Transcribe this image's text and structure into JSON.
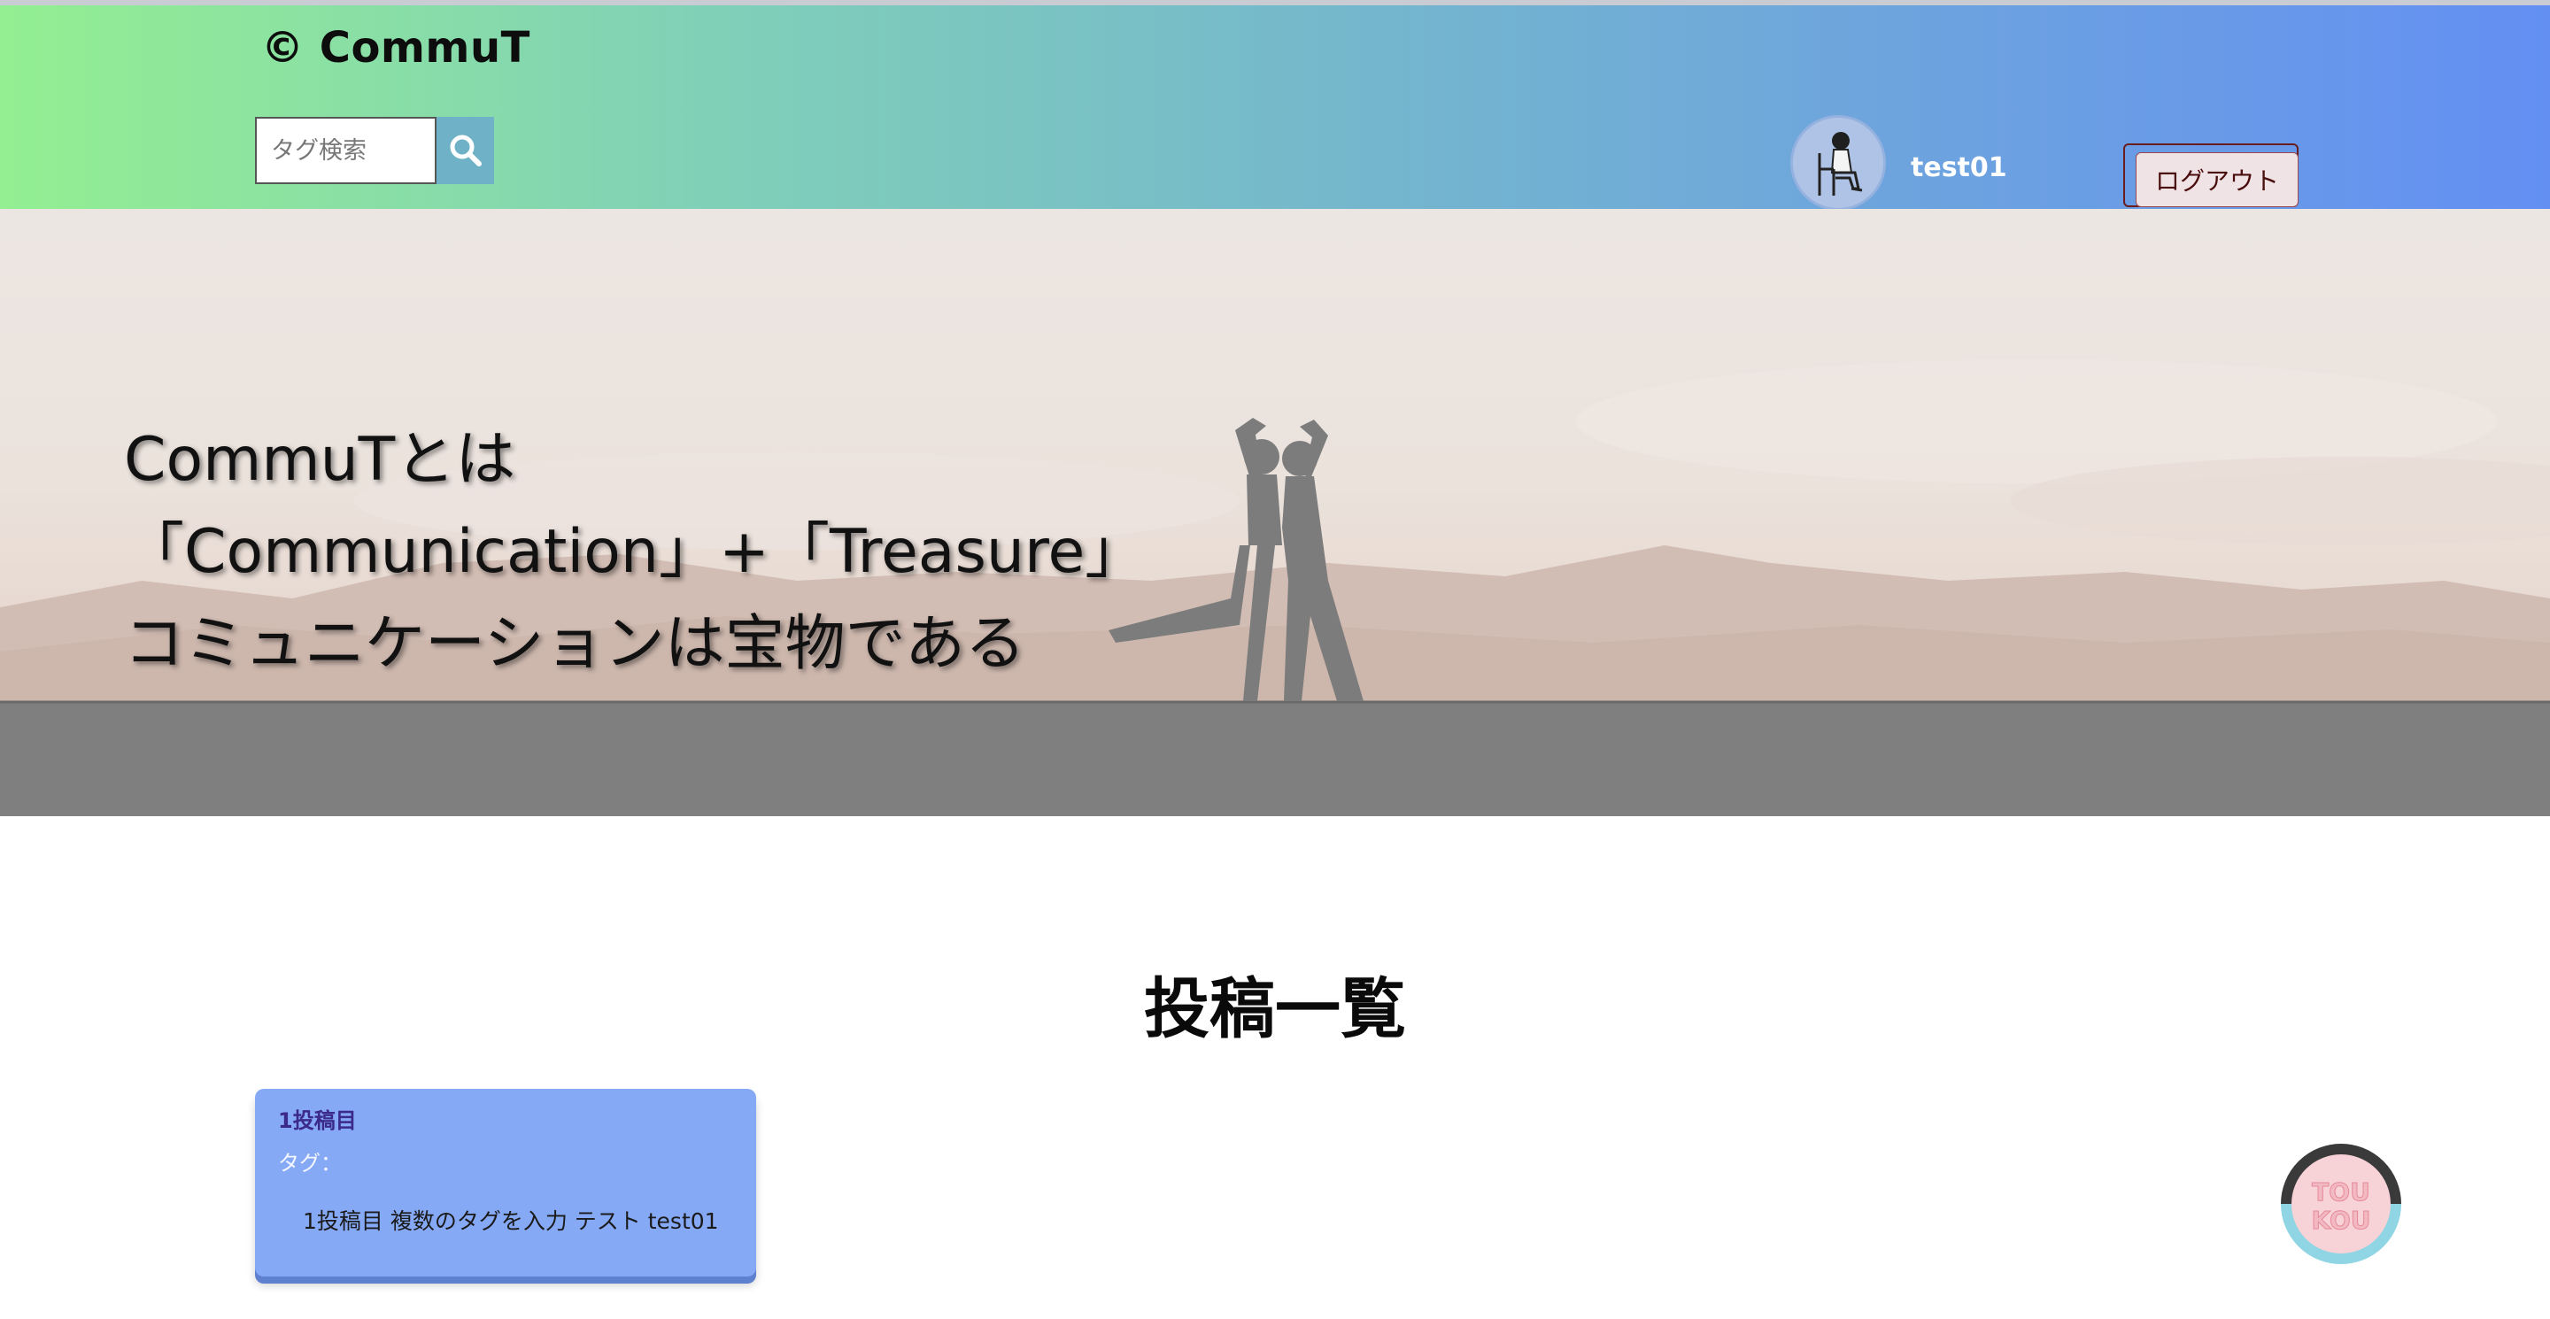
{
  "header": {
    "logo": "© CommuT",
    "search": {
      "placeholder": "タグ検索"
    },
    "user": {
      "name": "test01"
    },
    "logout_label": "ログアウト"
  },
  "hero": {
    "lines": [
      "CommuTとは",
      "「Communication」+「Treasure」",
      "コミュニケーションは宝物である"
    ]
  },
  "main": {
    "title": "投稿一覧",
    "posts": [
      {
        "title": "1投稿目",
        "tags_label": "タグ：",
        "body": "1投稿目 複数のタグを入力 テスト test01"
      }
    ]
  },
  "fab": {
    "line1": "TOU",
    "line2": "KOU"
  },
  "icons": {
    "search": "search-icon",
    "avatar": "avatar-image",
    "fab": "new-post-icon"
  },
  "colors": {
    "header_gradient_start": "#93ef91",
    "header_gradient_end": "#638ff3",
    "search_button": "#6fb1c6",
    "card": "#86a9f5",
    "card_title": "#3b2a8a",
    "logout_text": "#4a0d0d"
  }
}
